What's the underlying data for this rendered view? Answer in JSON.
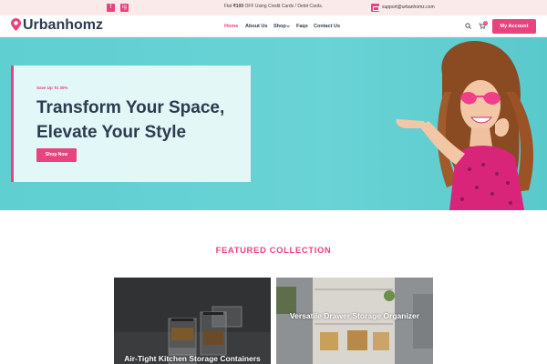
{
  "topbar": {
    "social": [
      "f",
      "ig"
    ],
    "promo_prefix": "Flat ",
    "promo_amount": "₹100",
    "promo_suffix": " OFF Using Credit Cards / Debit Cards.",
    "email": "support@urbanhomz.com"
  },
  "header": {
    "brand": "Urbanhomz",
    "nav": [
      "Home",
      "About Us",
      "Shop",
      "Faqs",
      "Contact Us"
    ],
    "cart_count": "0",
    "account_label": "My Account"
  },
  "hero": {
    "eyebrow": "Save Up To 30%",
    "title_line1": "Transform Your Space,",
    "title_line2": "Elevate Your Style",
    "cta": "Shop Now"
  },
  "featured": {
    "title": "FEATURED COLLECTION",
    "cards": [
      {
        "title": "Air-Tight Kitchen Storage Containers"
      },
      {
        "title": "Versatile Drawer Storage Organizer"
      }
    ]
  },
  "colors": {
    "accent": "#e8437e",
    "navy": "#2c3b4e",
    "hero_bg": "#66d1d4"
  },
  "icons": [
    "facebook-icon",
    "instagram-icon",
    "mail-icon",
    "location-pin-icon",
    "chevron-down-icon",
    "search-icon",
    "cart-icon"
  ]
}
